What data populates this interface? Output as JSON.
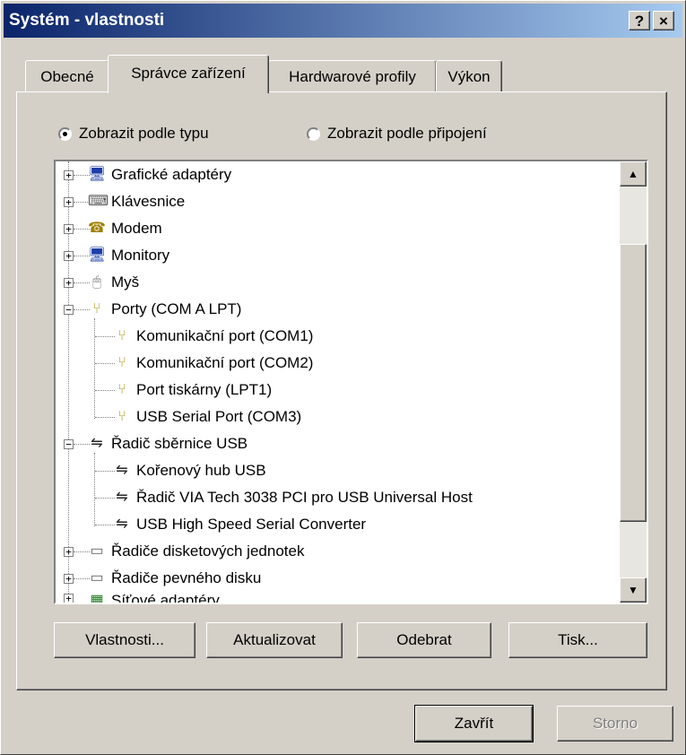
{
  "window": {
    "title": "Systém - vlastnosti",
    "help_label": "?",
    "close_label": "×"
  },
  "tabs": [
    {
      "label": "Obecné",
      "active": false
    },
    {
      "label": "Správce zařízení",
      "active": true
    },
    {
      "label": "Hardwarové profily",
      "active": false
    },
    {
      "label": "Výkon",
      "active": false
    }
  ],
  "view_options": [
    {
      "label": "Zobrazit podle typu",
      "checked": true
    },
    {
      "label": "Zobrazit podle připojení",
      "checked": false
    }
  ],
  "tree": [
    {
      "label": "Grafické adaptéry",
      "icon": "display-adapter-icon",
      "glyph": "🖥"
    },
    {
      "label": "Klávesnice",
      "icon": "keyboard-icon",
      "glyph": "⌨"
    },
    {
      "label": "Modem",
      "icon": "modem-icon",
      "glyph": "☎"
    },
    {
      "label": "Monitory",
      "icon": "monitor-icon",
      "glyph": "🖥"
    },
    {
      "label": "Myš",
      "icon": "mouse-icon",
      "glyph": "🖱"
    },
    {
      "label": "Porty (COM A LPT)",
      "icon": "port-icon",
      "glyph": "⑂"
    },
    {
      "label": "Komunikační port (COM1)",
      "icon": "port-icon",
      "glyph": "⑂"
    },
    {
      "label": "Komunikační port (COM2)",
      "icon": "port-icon",
      "glyph": "⑂"
    },
    {
      "label": "Port tiskárny (LPT1)",
      "icon": "port-icon",
      "glyph": "⑂"
    },
    {
      "label": "USB Serial Port (COM3)",
      "icon": "port-icon",
      "glyph": "⑂"
    },
    {
      "label": "Řadič sběrnice USB",
      "icon": "usb-icon",
      "glyph": "⇋"
    },
    {
      "label": "Kořenový hub USB",
      "icon": "usb-icon",
      "glyph": "⇋"
    },
    {
      "label": "Řadič VIA Tech 3038 PCI pro USB Universal Host",
      "icon": "usb-icon",
      "glyph": "⇋"
    },
    {
      "label": "USB High Speed Serial Converter",
      "icon": "usb-icon",
      "glyph": "⇋"
    },
    {
      "label": "Řadiče disketových jednotek",
      "icon": "disk-controller-icon",
      "glyph": "▭"
    },
    {
      "label": "Řadiče pevného disku",
      "icon": "disk-controller-icon",
      "glyph": "▭"
    },
    {
      "label": "Síťové adaptéry",
      "icon": "network-adapter-icon",
      "glyph": "▦"
    }
  ],
  "scroll": {
    "up_glyph": "▲",
    "down_glyph": "▼"
  },
  "actions": {
    "properties": "Vlastnosti...",
    "refresh": "Aktualizovat",
    "remove": "Odebrat",
    "print": "Tisk..."
  },
  "footer": {
    "close": "Zavřít",
    "cancel": "Storno"
  }
}
